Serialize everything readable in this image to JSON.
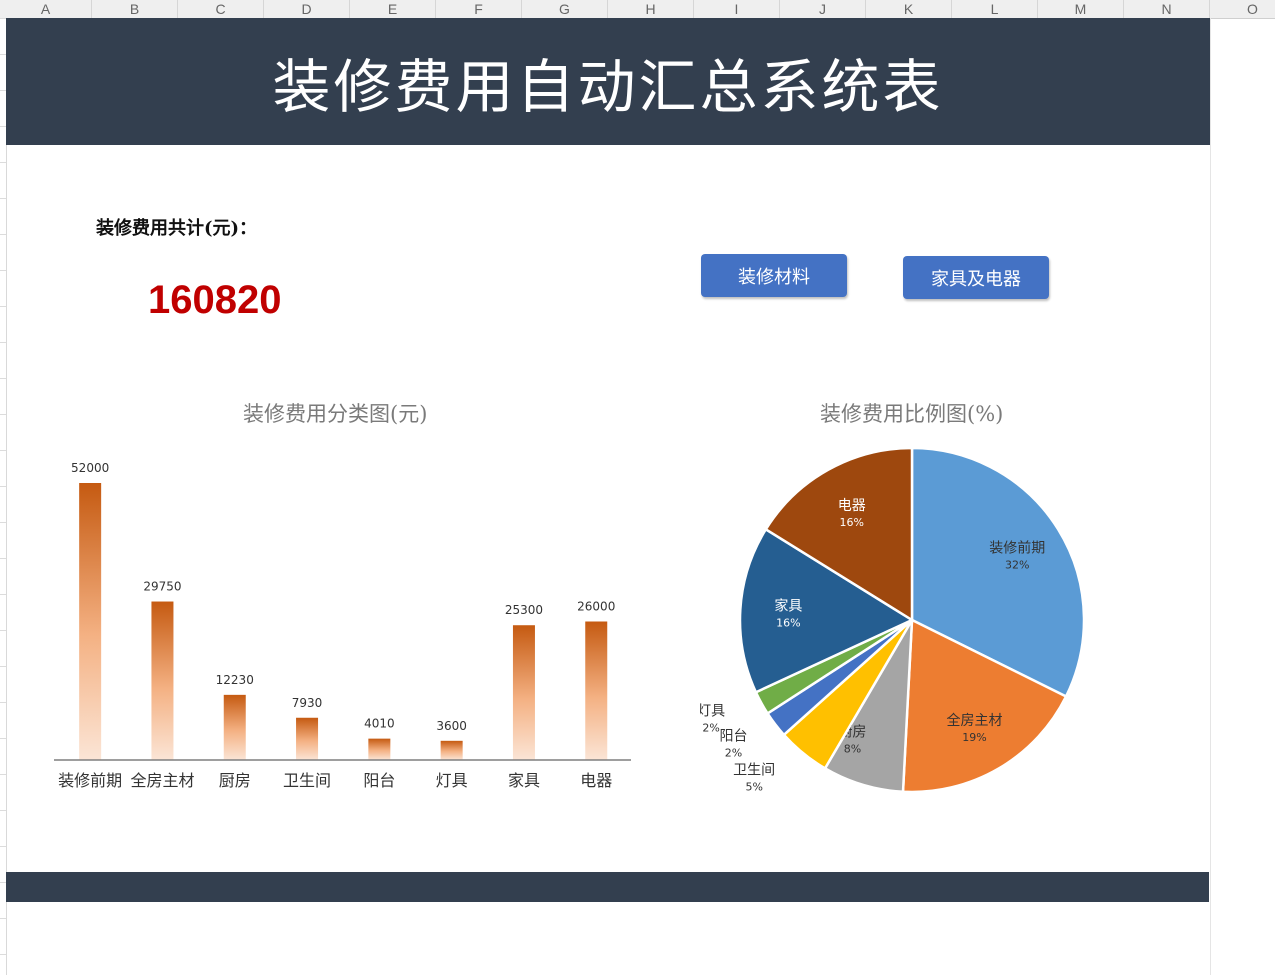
{
  "sheet": {
    "columns": [
      "A",
      "B",
      "C",
      "D",
      "E",
      "F",
      "G",
      "H",
      "I",
      "J",
      "K",
      "L",
      "M",
      "N",
      "O"
    ]
  },
  "banner": {
    "title": "装修费用自动汇总系统表"
  },
  "summary": {
    "label": "装修费用共计(元)：",
    "total": "160820"
  },
  "buttons": {
    "materials": "装修材料",
    "furniture": "家具及电器"
  },
  "colors": {
    "banner": "#333f4f",
    "button": "#4472c4",
    "total": "#c00000",
    "bar": "#c55a11"
  },
  "chart_data": [
    {
      "type": "bar",
      "title": "装修费用分类图(元)",
      "categories": [
        "装修前期",
        "全房主材",
        "厨房",
        "卫生间",
        "阳台",
        "灯具",
        "家具",
        "电器"
      ],
      "values": [
        52000,
        29750,
        12230,
        7930,
        4010,
        3600,
        25300,
        26000
      ],
      "ylim": [
        0,
        52000
      ],
      "grid": false,
      "legend": "none"
    },
    {
      "type": "pie",
      "title": "装修费用比例图(%)",
      "labels": [
        "装修前期",
        "全房主材",
        "厨房",
        "卫生间",
        "阳台",
        "灯具",
        "家具",
        "电器"
      ],
      "percent_labels": [
        "32%",
        "19%",
        "8%",
        "5%",
        "2%",
        "2%",
        "16%",
        "16%"
      ],
      "values": [
        52000,
        29750,
        12230,
        7930,
        4010,
        3600,
        25300,
        26000
      ],
      "colors": [
        "#5b9bd5",
        "#ed7d31",
        "#a5a5a5",
        "#ffc000",
        "#4472c4",
        "#70ad47",
        "#255e91",
        "#9e480e"
      ],
      "legend": "none"
    }
  ]
}
